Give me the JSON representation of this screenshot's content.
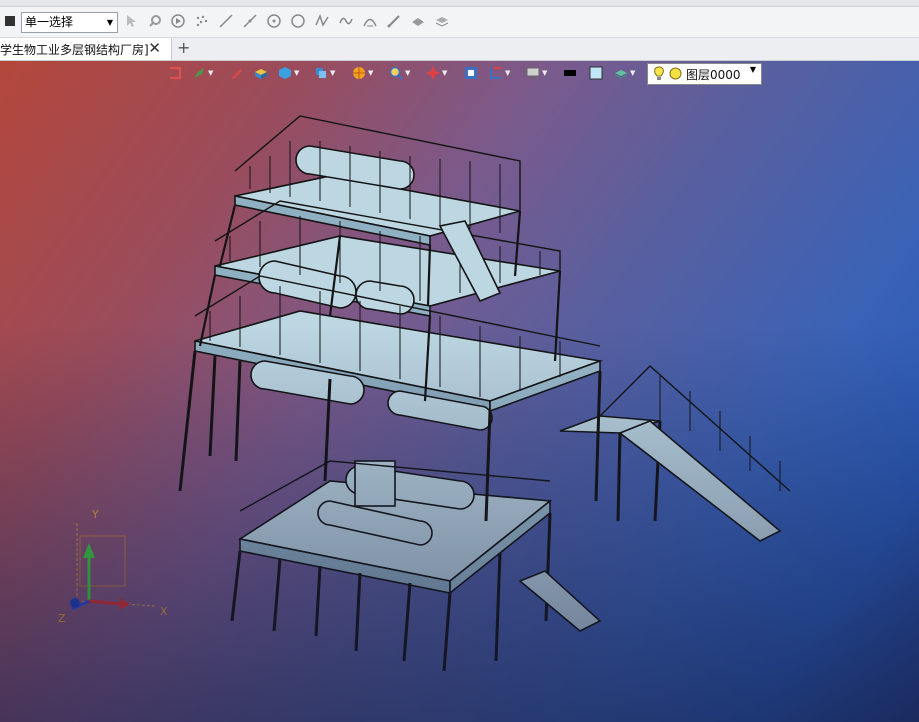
{
  "toolbar": {
    "select_mode": "单一选择",
    "icons": [
      "stop-icon",
      "cursor-icon",
      "filter-icon",
      "play-icon",
      "scatter-points-icon",
      "line-icon",
      "line2-icon",
      "circle-center-icon",
      "circle-icon",
      "curve-icon",
      "wave-icon",
      "arc-icon",
      "pen-icon",
      "surface-icon",
      "layer-stack-icon"
    ]
  },
  "tabs": [
    {
      "label": "学生物工业多层钢结构厂房]",
      "active": true
    }
  ],
  "view_toolbar": {
    "layer_label": "图层0000",
    "icons": [
      "snap-icon",
      "brush-icon",
      "pencil-icon",
      "box-icon",
      "cube-icon",
      "view-cube-icon",
      "sphere-render-icon",
      "zoom-icon",
      "pan-icon",
      "zoom-fit-icon",
      "section-icon",
      "monitor-icon",
      "line-color-icon",
      "fill-color-icon",
      "layer-visibility-icon",
      "lightbulb-icon"
    ]
  },
  "axes": {
    "x": "X",
    "y": "Y",
    "z": "Z"
  },
  "colors": {
    "model_fill": "#bcd6e2",
    "model_edge": "#141414",
    "bg_left": "#b4473b",
    "bg_right": "#2a5bb8"
  }
}
